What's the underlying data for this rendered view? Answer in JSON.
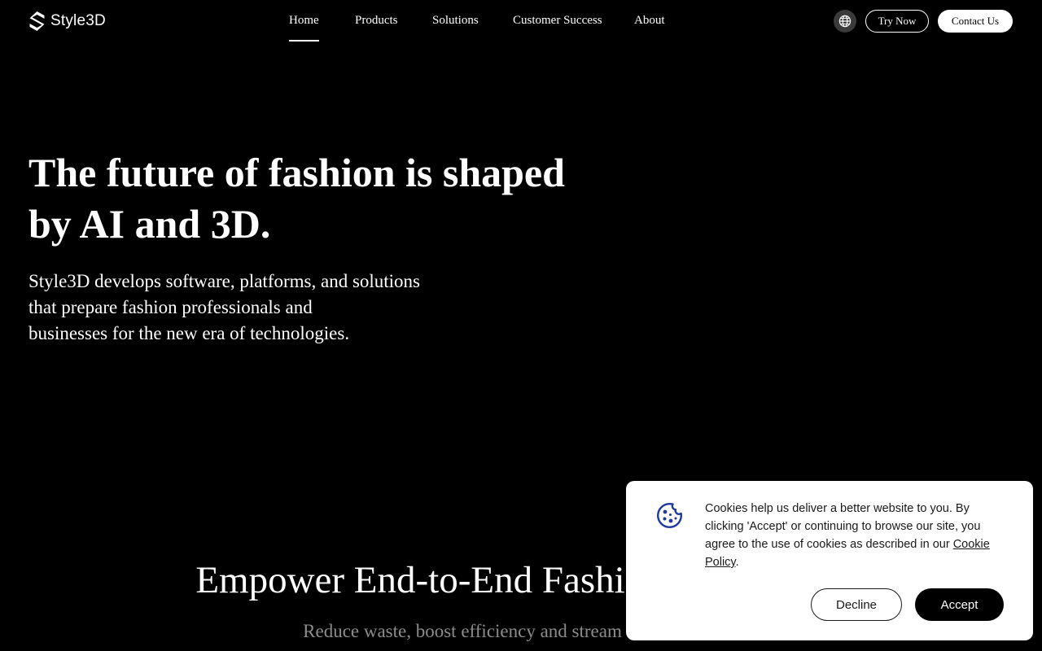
{
  "header": {
    "logo_text": "Style3D",
    "logo_icon": "style3d-logo-icon",
    "nav": [
      {
        "label": "Home",
        "active": true
      },
      {
        "label": "Products",
        "active": false
      },
      {
        "label": "Solutions",
        "active": false
      },
      {
        "label": "Customer Success",
        "active": false
      },
      {
        "label": "About",
        "active": false
      }
    ],
    "language_icon": "globe-icon",
    "try_now_label": "Try Now",
    "contact_label": "Contact Us"
  },
  "hero": {
    "title_line1": "The future of fashion is shaped",
    "title_line2": "by AI and 3D.",
    "subtitle_line1": "Style3D develops software, platforms, and solutions",
    "subtitle_line2": "that prepare fashion professionals and",
    "subtitle_line3": "businesses for the new era of technologies."
  },
  "section": {
    "title": "Empower End-to-End Fashi",
    "subtitle": "Reduce waste, boost efficiency and stream"
  },
  "cookie_banner": {
    "icon": "cookie-icon",
    "text": "Cookies help us deliver a better website to you. By clicking 'Accept' or continuing to browse our site, you agree to the use of cookies as described in our ",
    "link_text": "Cookie Policy",
    "text_end": ".",
    "decline_label": "Decline",
    "accept_label": "Accept",
    "accent_color": "#1f3a9e"
  }
}
